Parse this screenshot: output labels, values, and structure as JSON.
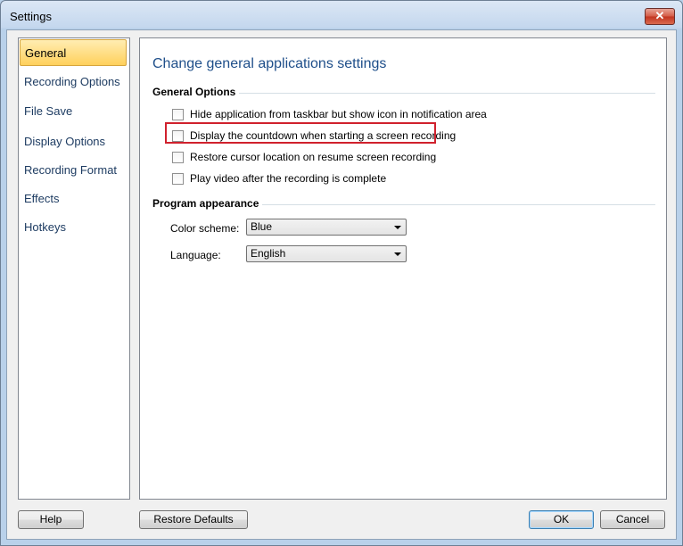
{
  "window": {
    "title": "Settings",
    "close_label": "✕"
  },
  "sidebar": {
    "items": [
      {
        "label": "General",
        "active": true
      },
      {
        "label": "Recording Options"
      },
      {
        "label": "File Save"
      },
      {
        "label": "Display Options"
      },
      {
        "label": "Recording Format"
      },
      {
        "label": "Effects"
      },
      {
        "label": "Hotkeys"
      }
    ]
  },
  "main": {
    "heading": "Change general applications settings",
    "general_options": {
      "title": "General Options",
      "options": [
        {
          "label": "Hide application from taskbar but show icon in notification area",
          "checked": false
        },
        {
          "label": "Display the countdown when starting a screen recording",
          "checked": false
        },
        {
          "label": "Restore cursor location on resume screen recording",
          "checked": false
        },
        {
          "label": "Play video after the recording is complete",
          "checked": false
        }
      ]
    },
    "appearance": {
      "title": "Program appearance",
      "color_scheme_label": "Color scheme:",
      "color_scheme_value": "Blue",
      "language_label": "Language:",
      "language_value": "English"
    }
  },
  "footer": {
    "help_label": "Help",
    "restore_label": "Restore Defaults",
    "ok_label": "OK",
    "cancel_label": "Cancel"
  },
  "colors": {
    "highlight": "#d0212d",
    "active_nav": "#ffd15c",
    "heading": "#1f4f8a"
  }
}
